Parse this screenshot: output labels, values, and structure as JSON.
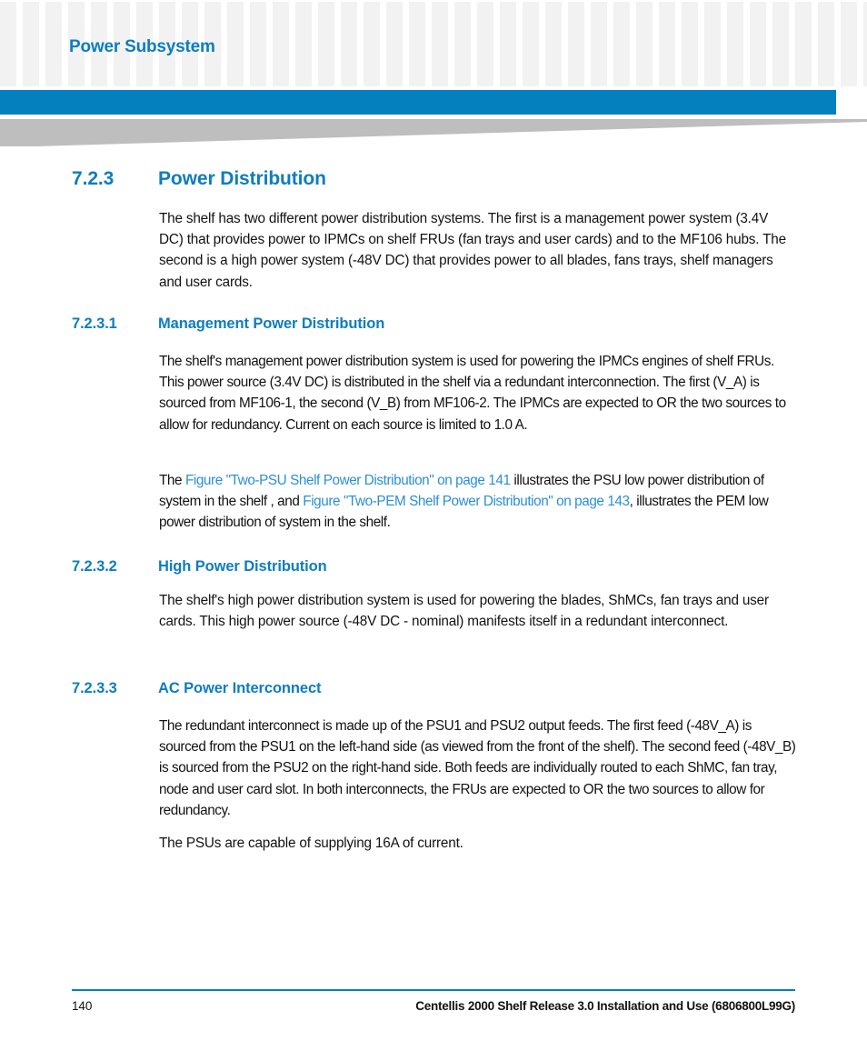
{
  "header": {
    "chapter_title": "Power Subsystem",
    "accent_color": "#0580BE",
    "heading_color": "#0E7DBE",
    "link_color": "#2B8FD4",
    "check_color": "#f2f2f2",
    "swoosh_color": "#BEBEBE"
  },
  "sections": {
    "s723": {
      "number": "7.2.3",
      "title": "Power Distribution",
      "body": "The shelf has two different power distribution systems. The first is a management power system (3.4V DC) that provides power to IPMCs on shelf FRUs (fan trays and user cards) and to the MF106 hubs. The second is a high power system (-48V DC) that provides power to all blades, fans trays, shelf managers and user cards."
    },
    "s7231": {
      "number": "7.2.3.1",
      "title": "Management Power Distribution",
      "body": "The shelf's management power distribution system is used for powering the IPMCs engines of shelf FRUs. This power source (3.4V DC) is distributed in the shelf via a redundant interconnection. The first (V_A) is sourced from MF106-1, the second (V_B) from MF106-2. The IPMCs are expected to OR the two sources to allow for redundancy. Current on each source is limited to 1.0 A.",
      "xref_para": {
        "lead": "The ",
        "link1": "Figure \"Two-PSU Shelf Power Distribution\" on page 141",
        "mid": " illustrates the PSU low power distribution of system in the shelf , and ",
        "link2": "Figure \"Two-PEM Shelf Power Distribution\" on page 143",
        "tail": ", illustrates the PEM low power distribution of system in the shelf."
      }
    },
    "s7232": {
      "number": "7.2.3.2",
      "title": "High Power Distribution",
      "body": "The shelf's high power distribution system is used for powering the blades, ShMCs, fan trays and user cards. This high power source (-48V DC - nominal) manifests itself in a redundant interconnect."
    },
    "s7233": {
      "number": "7.2.3.3",
      "title": "AC Power Interconnect",
      "body": "The redundant interconnect is made up of the PSU1 and PSU2 output feeds. The first feed (-48V_A) is sourced from the PSU1 on the left-hand side (as viewed from the front of the shelf). The second feed (-48V_B) is sourced from the PSU2 on the right-hand side. Both feeds are individually routed to each ShMC, fan tray, node and user card slot. In both interconnects, the FRUs are expected to OR the two sources to allow for redundancy.",
      "body2": "The PSUs are capable of supplying 16A of current."
    }
  },
  "footer": {
    "page_number": "140",
    "document_title": "Centellis 2000 Shelf Release 3.0 Installation and Use (6806800L99G)"
  }
}
